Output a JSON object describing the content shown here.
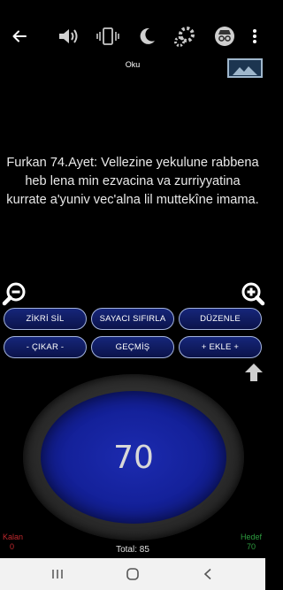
{
  "toolbar": {
    "icons": [
      "back-arrow-icon",
      "volume-icon",
      "vibration-icon",
      "moon-icon",
      "gear-icon",
      "incognito-icon",
      "more-vert-icon"
    ]
  },
  "mode_label": "Oku",
  "verse_text": "Furkan 74.Ayet: Vellezine yekulune rabbena heb lena min ezvacina va zurriyyatina kurrate a'yuniv vec'alna lil muttekîne imama.",
  "buttons": {
    "delete_zikr": "ZİKRİ SİL",
    "reset_counter": "SAYACI SIFIRLA",
    "edit": "DÜZENLE",
    "subtract": "- ÇIKAR -",
    "history": "GEÇMİŞ",
    "add": "+ EKLE +"
  },
  "counter": {
    "value": "70"
  },
  "stats": {
    "remaining_label": "Kalan",
    "remaining_value": "0",
    "target_label": "Hedef",
    "target_value": "70",
    "total_text": "Total: 85"
  },
  "colors": {
    "counter_blue": "#14219a",
    "button_border": "#a4b4de",
    "remaining_red": "#c0282d",
    "target_green": "#2d9c3f"
  }
}
